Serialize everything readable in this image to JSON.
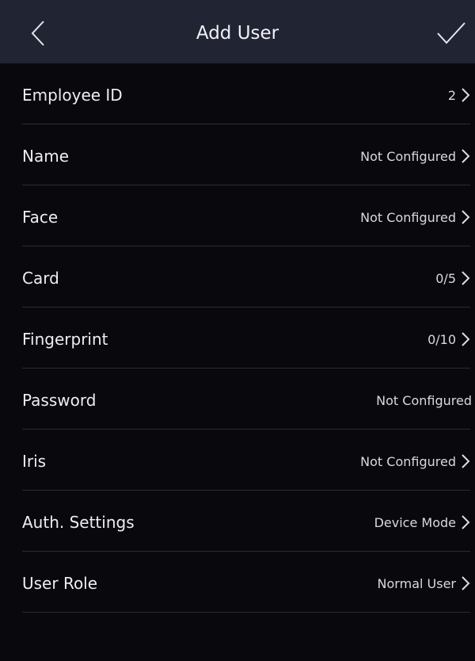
{
  "header": {
    "title": "Add User",
    "back_icon": "chevron-left-icon",
    "confirm_icon": "checkmark-icon"
  },
  "rows": [
    {
      "label": "Employee ID",
      "value": "2"
    },
    {
      "label": "Name",
      "value": "Not Configured"
    },
    {
      "label": "Face",
      "value": "Not Configured"
    },
    {
      "label": "Card",
      "value": "0/5"
    },
    {
      "label": "Fingerprint",
      "value": "0/10"
    },
    {
      "label": "Password",
      "value": "Not Configured"
    },
    {
      "label": "Iris",
      "value": "Not Configured"
    },
    {
      "label": "Auth. Settings",
      "value": "Device Mode"
    },
    {
      "label": "User Role",
      "value": "Normal User"
    }
  ],
  "colors": {
    "header_bg": "#212433",
    "body_bg": "#09090d",
    "divider": "#2b2c33"
  }
}
